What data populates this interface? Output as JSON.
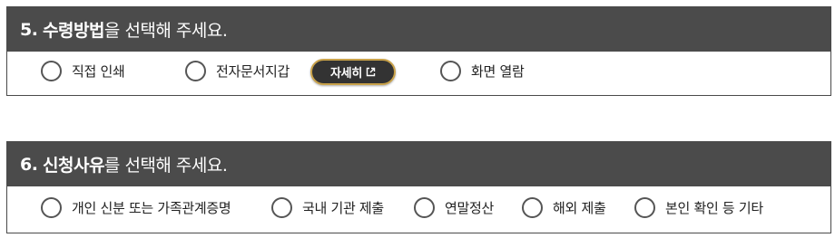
{
  "section5": {
    "number": "5.",
    "title_bold": "수령방법",
    "title_rest": "을 선택해 주세요.",
    "options": [
      {
        "label": "직접 인쇄"
      },
      {
        "label": "전자문서지갑"
      },
      {
        "label": "화면 열람"
      }
    ],
    "detail_button": {
      "label": "자세히",
      "icon": "external-link-icon"
    }
  },
  "section6": {
    "number": "6.",
    "title_bold": "신청사유",
    "title_rest": "를 선택해 주세요.",
    "options": [
      {
        "label": "개인 신분 또는 가족관계증명"
      },
      {
        "label": "국내 기관 제출"
      },
      {
        "label": "연말정산"
      },
      {
        "label": "해외 제출"
      },
      {
        "label": "본인 확인 등 기타"
      }
    ]
  },
  "colors": {
    "header_bg": "#4b4b4b",
    "button_bg": "#333333",
    "button_border": "#c9a24a"
  }
}
